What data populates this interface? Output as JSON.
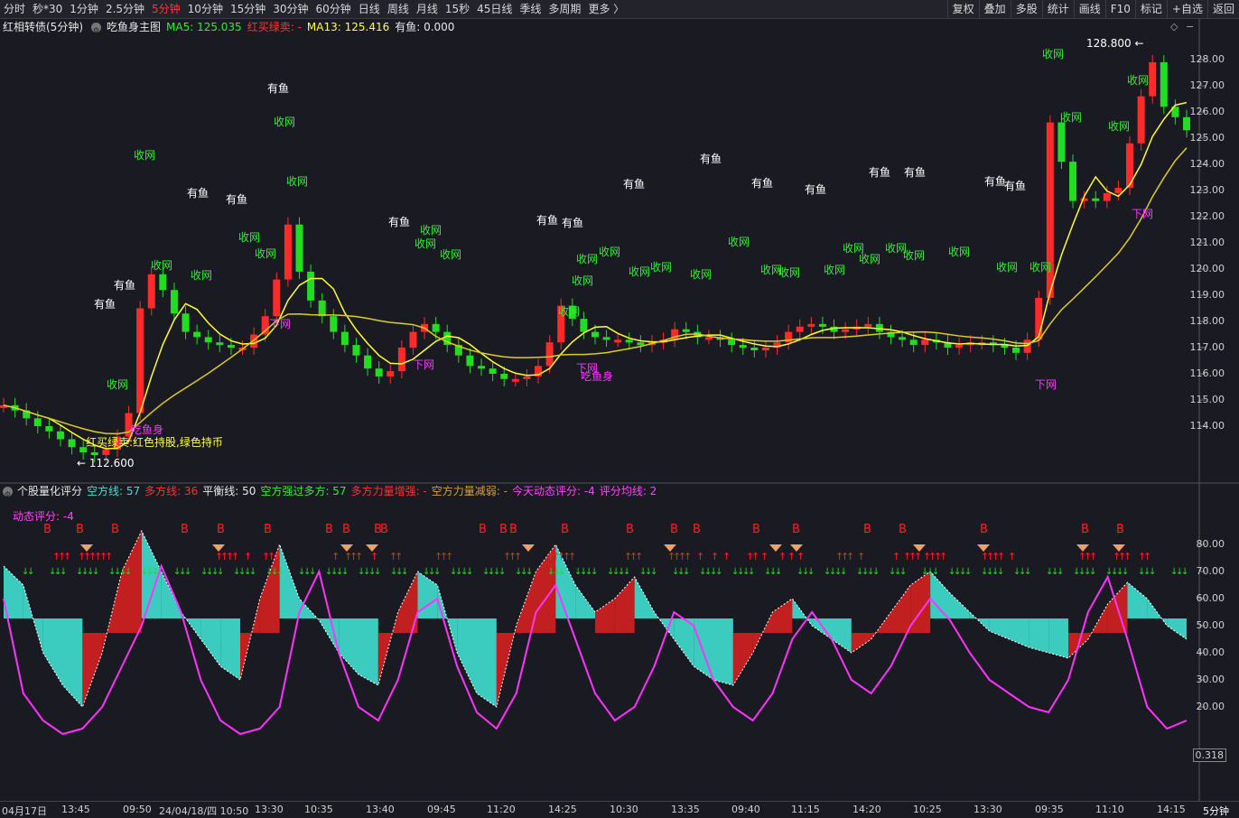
{
  "toolbar": {
    "periods": [
      "分时",
      "秒*30",
      "1分钟",
      "2.5分钟",
      "5分钟",
      "10分钟",
      "15分钟",
      "30分钟",
      "60分钟",
      "日线",
      "周线",
      "月线",
      "15秒",
      "45日线",
      "季线",
      "多周期",
      "更多 〉"
    ],
    "active_period": "5分钟",
    "right_buttons": [
      "复权",
      "叠加",
      "多股",
      "统计",
      "画线",
      "F10",
      "标记",
      "+自选",
      "返回"
    ]
  },
  "main_legend": {
    "name": "红相转债(5分钟)",
    "formula": "吃鱼身主图",
    "ma5": "MA5: 125.035",
    "hongmai": "红买绿卖: -",
    "ma13": "MA13: 125.416",
    "youyu": "有鱼: 0.000"
  },
  "indicator_legend": {
    "name": "个股量化评分",
    "kongfang": "空方线: 57",
    "duofang": "多方线: 36",
    "pingheng": "平衡线: 50",
    "kqgdf": "空方强过多方: 57",
    "dfzq": "多方力量增强: -",
    "kfjr": "空方力量减弱: -",
    "jtdt": "今天动态评分: -4",
    "pfjx": "评分均线: 2",
    "dongtai": "动态评分: -4"
  },
  "price_axis": [
    "128.00",
    "127.00",
    "126.00",
    "125.00",
    "124.00",
    "123.00",
    "122.00",
    "121.00",
    "120.00",
    "119.00",
    "118.00",
    "117.00",
    "116.00",
    "115.00",
    "114.00"
  ],
  "indicator_axis": [
    "80.00",
    "70.00",
    "60.00",
    "50.00",
    "40.00",
    "30.00",
    "20.00"
  ],
  "indicator_current": "0.318",
  "time_labels": [
    "04月17日",
    "13:45",
    "09:50",
    "24/04/18/四 10:50",
    "13:30",
    "10:35",
    "13:40",
    "09:45",
    "11:20",
    "14:25",
    "10:30",
    "13:35",
    "09:40",
    "11:15",
    "14:20",
    "10:25",
    "13:30",
    "09:35",
    "11:10",
    "14:15"
  ],
  "period_label": "5分钟",
  "annotations": {
    "high": "128.800",
    "low": "112.600",
    "legend_note": "红买绿卖:红色持股,绿色持币",
    "eat_fish": "吃鱼身",
    "youyu": "有鱼",
    "shouwang": "收网",
    "xiawang": "下网",
    "buy": "B"
  },
  "colors": {
    "up": "#ff2a2a",
    "down": "#22dd22",
    "ma5": "#ffff33",
    "ma13": "#ffff33",
    "kong": "#40e0d0",
    "duo": "#d42020",
    "score": "#ff33ff"
  },
  "chart_data": {
    "type": "candlestick",
    "price_range": [
      112.6,
      128.8
    ],
    "score_range": [
      0,
      90
    ],
    "price_series": [
      114.8,
      114.6,
      114.3,
      114.0,
      113.8,
      113.5,
      113.2,
      113.0,
      112.9,
      113.1,
      113.6,
      114.5,
      118.5,
      119.8,
      119.2,
      118.3,
      117.6,
      117.4,
      117.2,
      117.1,
      117.0,
      117.0,
      117.5,
      118.2,
      119.6,
      121.7,
      119.9,
      118.8,
      118.2,
      117.6,
      117.1,
      116.7,
      116.2,
      115.9,
      116.1,
      117.0,
      117.6,
      117.9,
      117.6,
      117.1,
      116.7,
      116.3,
      116.2,
      116.0,
      115.8,
      115.8,
      115.9,
      116.3,
      117.2,
      118.6,
      118.1,
      117.6,
      117.4,
      117.3,
      117.3,
      117.2,
      117.1,
      117.2,
      117.3,
      117.7,
      117.6,
      117.4,
      117.4,
      117.3,
      117.1,
      117.0,
      116.9,
      117.0,
      117.2,
      117.6,
      117.8,
      117.9,
      117.8,
      117.6,
      117.7,
      117.8,
      117.9,
      117.6,
      117.4,
      117.3,
      117.1,
      117.3,
      117.2,
      117.0,
      117.1,
      117.2,
      117.2,
      117.1,
      117.0,
      116.8,
      117.3,
      118.9,
      125.6,
      124.1,
      122.6,
      122.7,
      122.6,
      122.9,
      123.1,
      124.8,
      126.6,
      127.9,
      126.2,
      125.8,
      125.3
    ]
  }
}
